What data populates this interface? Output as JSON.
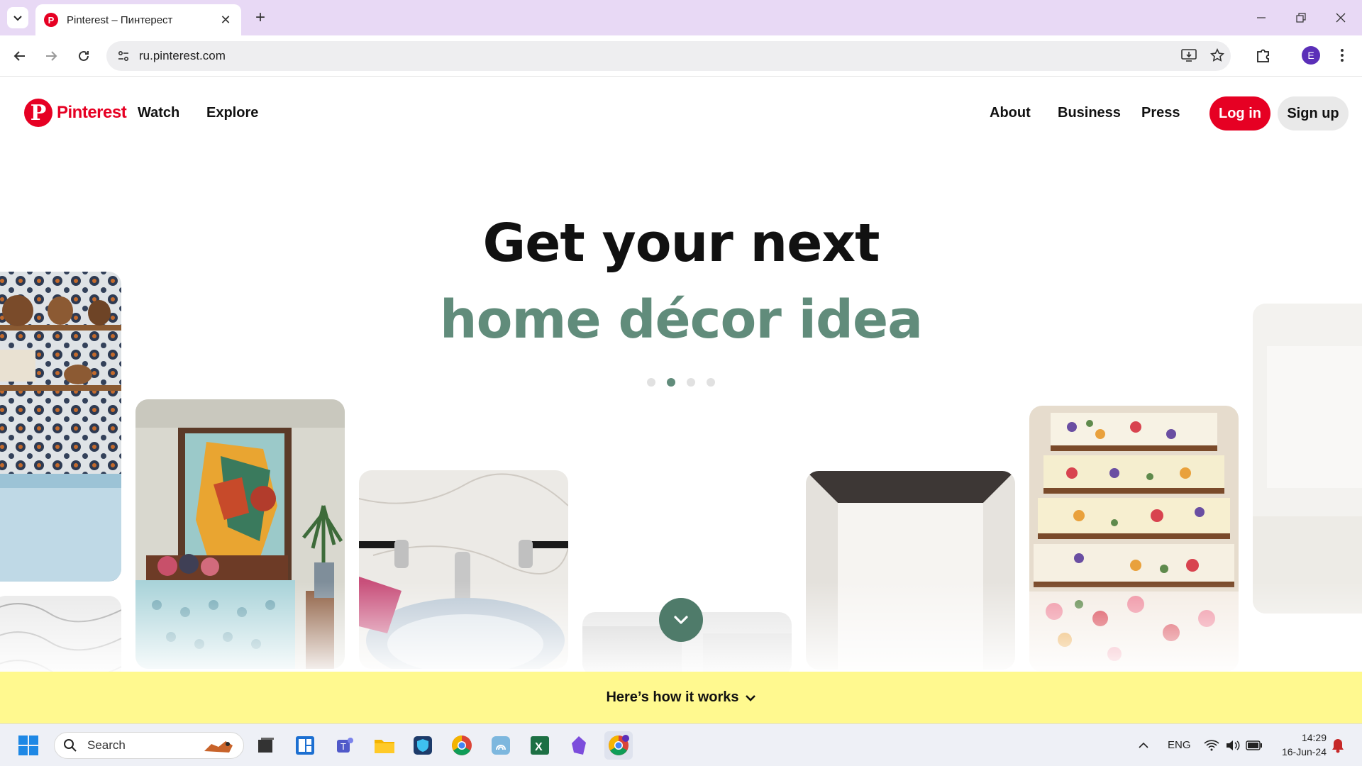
{
  "browser": {
    "tab_title": "Pinterest – Пинтерест",
    "favicon_letter": "P",
    "url": "ru.pinterest.com",
    "profile_initial": "E"
  },
  "header": {
    "logo_text": "Pinterest",
    "nav_left": [
      "Watch",
      "Explore"
    ],
    "nav_right": [
      "About",
      "Business",
      "Press"
    ],
    "login_label": "Log in",
    "signup_label": "Sign up"
  },
  "hero": {
    "line1": "Get your next",
    "line2": "home décor idea",
    "carousel_dots": 4,
    "active_dot": 2,
    "accent_color": "#618c7b"
  },
  "banner": {
    "text": "Here’s how it works",
    "bg_color": "#fff98f"
  },
  "taskbar": {
    "search_placeholder": "Search",
    "language": "ENG",
    "time": "14:29",
    "date": "16-Jun-24",
    "apps": [
      "windows-start",
      "task-view",
      "widgets",
      "teams",
      "file-explorer",
      "vpn",
      "chrome",
      "files",
      "excel",
      "obsidian",
      "chrome-profile"
    ]
  },
  "colors": {
    "pinterest_red": "#e60023",
    "tab_strip": "#e8d9f5"
  }
}
